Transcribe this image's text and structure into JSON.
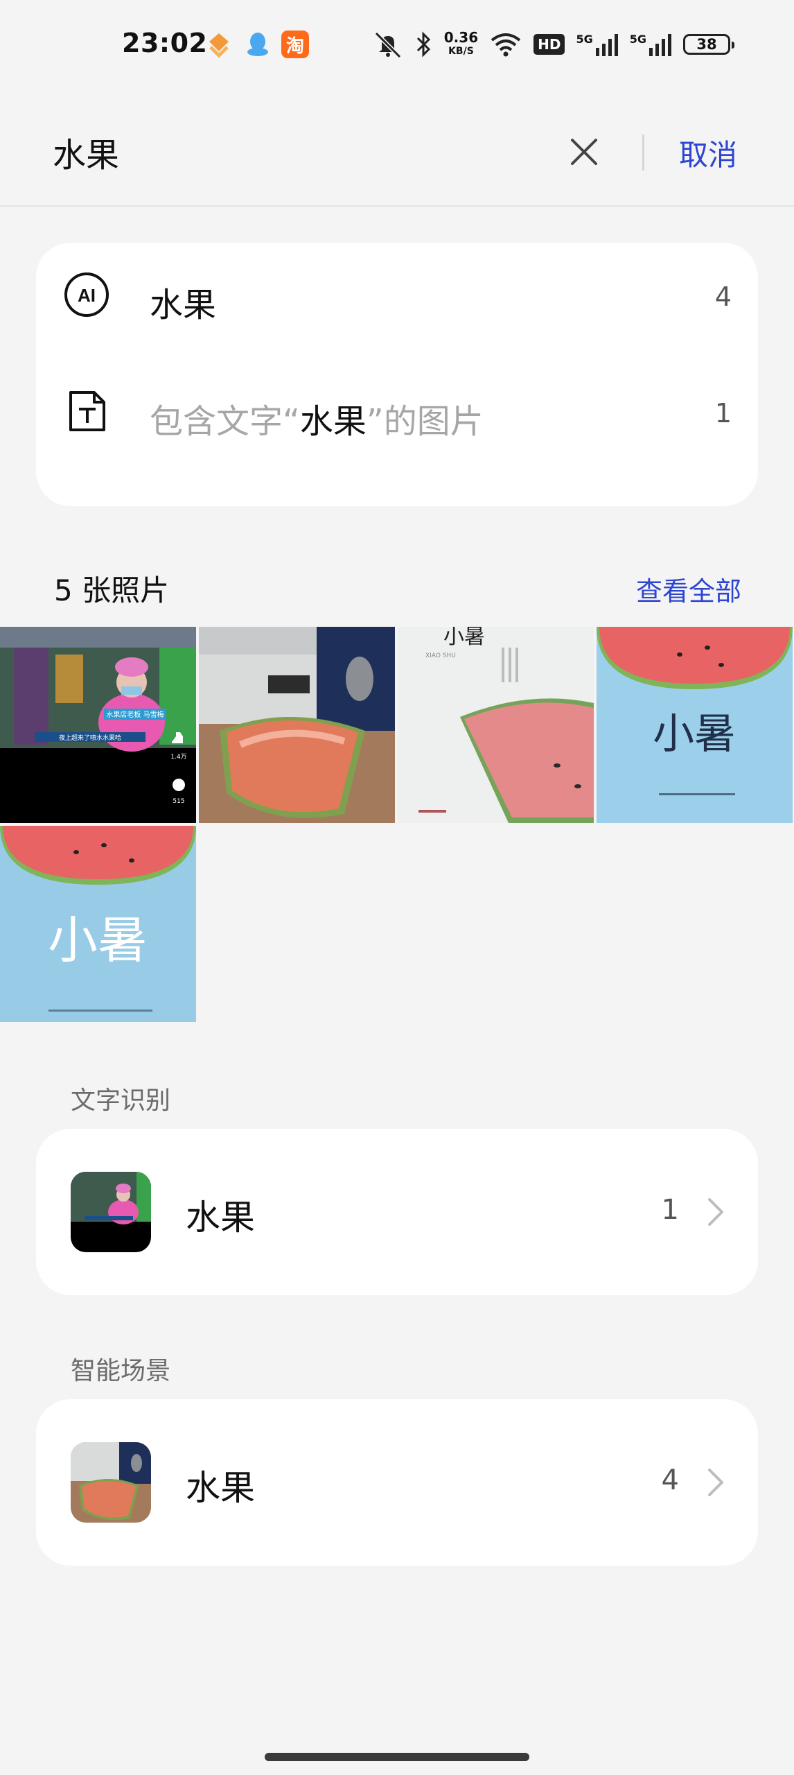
{
  "status_bar": {
    "time": "23:02",
    "apps": [
      "heart-app-icon",
      "qq-icon",
      "taobao-icon"
    ],
    "taobao_char": "淘",
    "speed_value": "0.36",
    "speed_unit": "KB/S",
    "hd_label": "HD",
    "network_5g": "5G",
    "battery": "38"
  },
  "search": {
    "query": "水果",
    "cancel_label": "取消"
  },
  "suggestions": [
    {
      "icon": "ai-icon",
      "label": "水果",
      "count": "4"
    },
    {
      "icon": "text-doc-icon",
      "label_prefix": "包含文字“",
      "label_keyword": "水果",
      "label_suffix": "”的图片",
      "count": "1"
    }
  ],
  "photos_section": {
    "title": "5 张照片",
    "view_all_label": "查看全部",
    "photos": [
      {
        "name": "photo-market-woman",
        "overlay_texts": [
          "水果店老板 马雪梅",
          "夜上超来了喷水水果哈",
          "1.4万",
          "515"
        ]
      },
      {
        "name": "photo-watermelon-desk"
      },
      {
        "name": "photo-xiaoshu-poster-white",
        "overlay_texts": [
          "小暑",
          "XIAO SHU"
        ]
      },
      {
        "name": "photo-xiaoshu-poster-blue",
        "overlay_texts": [
          "小暑"
        ]
      },
      {
        "name": "photo-xiaoshu-poster-blue-2",
        "overlay_texts": [
          "小暑"
        ]
      }
    ]
  },
  "text_recognition": {
    "title": "文字识别",
    "item": {
      "label": "水果",
      "count": "1"
    }
  },
  "smart_scene": {
    "title": "智能场景",
    "item": {
      "label": "水果",
      "count": "4"
    }
  },
  "colors": {
    "accent": "#2e45d1",
    "background": "#f4f4f4",
    "card": "#ffffff"
  }
}
